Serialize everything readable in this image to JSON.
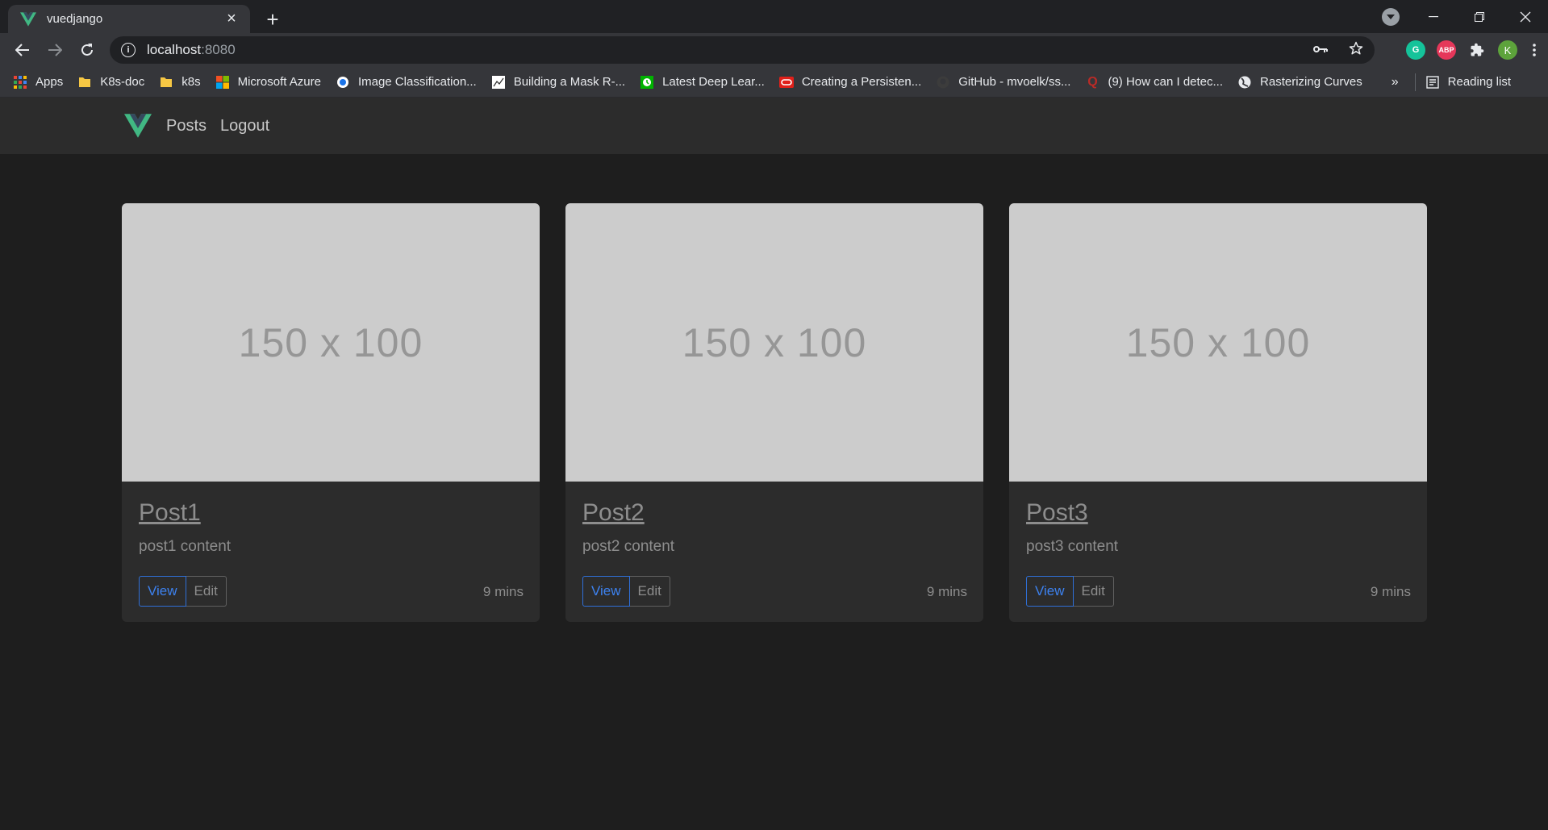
{
  "browser": {
    "tab_title": "vuedjango",
    "url_host": "localhost",
    "url_port": ":8080",
    "profile_initial": "K",
    "bookmarks": [
      {
        "label": "Apps",
        "icon": "apps-grid-icon"
      },
      {
        "label": "K8s-doc",
        "icon": "folder-icon"
      },
      {
        "label": "k8s",
        "icon": "folder-icon"
      },
      {
        "label": "Microsoft Azure",
        "icon": "microsoft-icon"
      },
      {
        "label": "Image Classification...",
        "icon": "site-icon"
      },
      {
        "label": "Building a Mask R-...",
        "icon": "site-icon"
      },
      {
        "label": "Latest Deep Lear...",
        "icon": "site-icon"
      },
      {
        "label": "Creating a Persisten...",
        "icon": "oracle-icon"
      },
      {
        "label": "GitHub - mvoelk/ss...",
        "icon": "github-icon"
      },
      {
        "label": "(9) How can I detec...",
        "icon": "quora-icon"
      },
      {
        "label": "Rasterizing Curves",
        "icon": "globe-icon"
      }
    ],
    "bookmarks_more": "»",
    "reading_list": "Reading list"
  },
  "app": {
    "nav": {
      "posts": "Posts",
      "logout": "Logout"
    },
    "cards": [
      {
        "image_text": "150 x 100",
        "title": "Post1",
        "text": "post1 content",
        "view": "View",
        "edit": "Edit",
        "time": "9 mins"
      },
      {
        "image_text": "150 x 100",
        "title": "Post2",
        "text": "post2 content",
        "view": "View",
        "edit": "Edit",
        "time": "9 mins"
      },
      {
        "image_text": "150 x 100",
        "title": "Post3",
        "text": "post3 content",
        "view": "View",
        "edit": "Edit",
        "time": "9 mins"
      }
    ]
  },
  "colors": {
    "vue_green": "#41b883",
    "vue_dark": "#35495e",
    "primary_blue": "#3d82f0"
  }
}
